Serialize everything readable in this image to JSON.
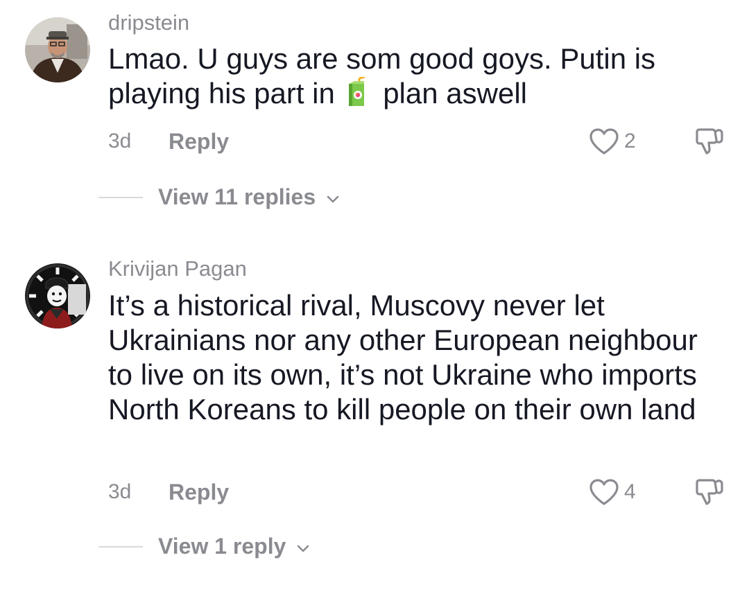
{
  "comments": [
    {
      "username": "dripstein",
      "text_line1": "Lmao. U guys are som good goys. Putin is",
      "text_line2_before": "playing his part in",
      "emoji": "juice-box-emoji",
      "text_line2_after": "plan aswell",
      "time": "3d",
      "reply_label": "Reply",
      "likes": "2",
      "view_replies": "View 11 replies"
    },
    {
      "username": "Krivijan Pagan",
      "text": "It’s a historical rival, Muscovy never let Ukrainians nor any other European neighbour to live on its own, it’s not Ukraine who imports North Koreans to kill people on their own land",
      "time": "3d",
      "reply_label": "Reply",
      "likes": "4",
      "view_replies": "View 1 reply"
    }
  ],
  "icons": {
    "like": "heart-outline-icon",
    "dislike": "thumbs-down-icon",
    "expand": "chevron-down-icon"
  },
  "colors": {
    "text": "#161823",
    "muted": "#8a8b91",
    "divider": "#d9d9dc"
  }
}
